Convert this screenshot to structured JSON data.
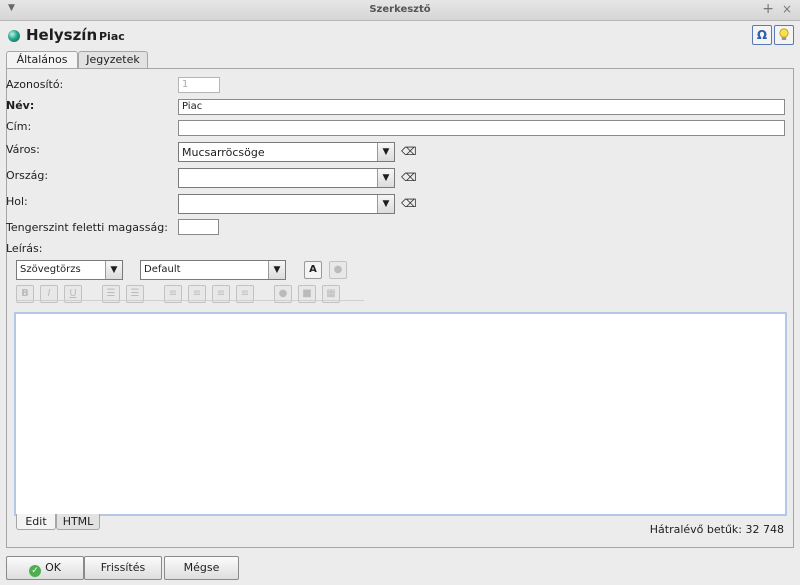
{
  "window": {
    "title": "Szerkesztő"
  },
  "header": {
    "title": "Helyszín",
    "subtitle": "Piac",
    "omega_glyph": "Ω"
  },
  "tabs": [
    "Általános",
    "Jegyzetek"
  ],
  "form": {
    "id_label": "Azonosító:",
    "id_value": "1",
    "name_label": "Név:",
    "name_value": "Piac",
    "address_label": "Cím:",
    "address_value": "",
    "city_label": "Város:",
    "city_value": "Mucsarröcsöge",
    "country_label": "Ország:",
    "country_value": "",
    "where_label": "Hol:",
    "where_value": "",
    "altitude_label": "Tengerszint feletti magasság:",
    "altitude_value": "",
    "description_label": "Leírás:"
  },
  "editor": {
    "style_select": "Szövegtörzs",
    "font_select": "Default",
    "format_buttons": [
      "B",
      "I",
      "U"
    ],
    "tabs": [
      "Edit",
      "HTML"
    ],
    "remaining_label": "Hátralévő betűk: 32 748"
  },
  "buttons": {
    "ok": "OK",
    "refresh": "Frissítés",
    "cancel": "Mégse"
  }
}
